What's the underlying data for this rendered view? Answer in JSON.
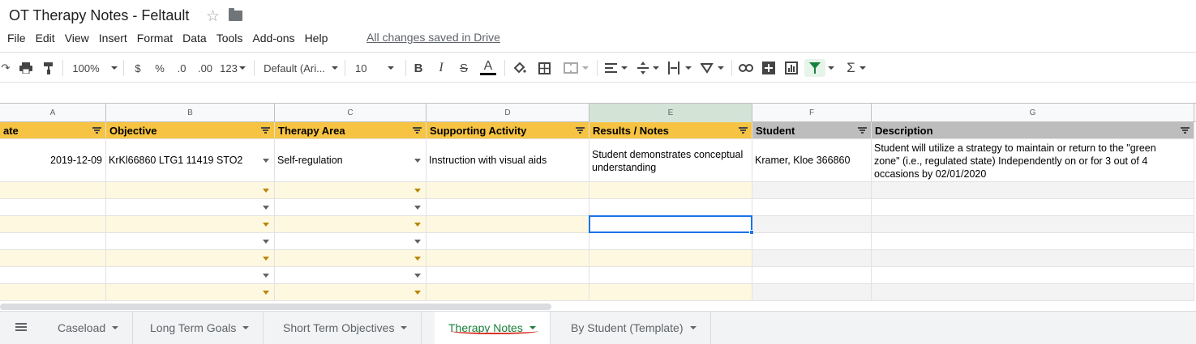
{
  "app": {
    "title": "OT Therapy Notes - Feltault",
    "save_status": "All changes saved in Drive"
  },
  "menu": [
    "File",
    "Edit",
    "View",
    "Insert",
    "Format",
    "Data",
    "Tools",
    "Add-ons",
    "Help"
  ],
  "toolbar": {
    "zoom": "100%",
    "currency": "$",
    "percent": "%",
    "dec_less": ".0",
    "dec_more": ".00",
    "more_formats": "123",
    "font": "Default (Ari...",
    "font_size": "10",
    "bold": "B",
    "italic": "I",
    "strike": "S",
    "text_color": "A",
    "functions": "Σ",
    "active_color": "#188038"
  },
  "columns": [
    "A",
    "B",
    "C",
    "D",
    "E",
    "F",
    "G"
  ],
  "headers": [
    "ate",
    "Objective",
    "Therapy Area",
    "Supporting Activity",
    "Results / Notes",
    "Student",
    "Description"
  ],
  "rows": [
    {
      "date": "2019-12-09",
      "objective": "KrKl66860 LTG1 11419 STO2",
      "area": "Self-regulation",
      "activity": "Instruction with visual aids",
      "results": "Student demonstrates conceptual understanding",
      "student": "Kramer, Kloe 366860",
      "description": "Student will utilize a strategy to maintain or return to the \"green zone\" (i.e., regulated state) Independently on or for 3 out of 4 occasions by 02/01/2020"
    }
  ],
  "sheet_tabs": [
    "Caseload",
    "Long Term Goals",
    "Short Term Objectives",
    "Therapy Notes",
    "By Student (Template)"
  ],
  "active_tab": "Therapy Notes",
  "colors": {
    "header_yellow": "#f6c342",
    "header_gray": "#bdbdbd",
    "row_tint": "#fff8e1",
    "selection": "#1a73e8"
  }
}
